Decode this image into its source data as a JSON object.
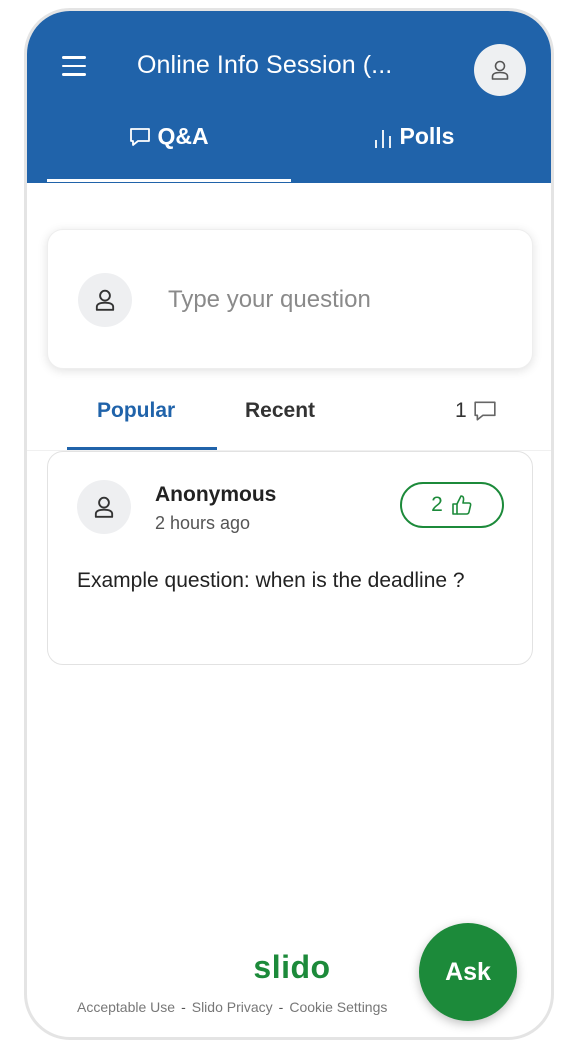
{
  "header": {
    "event_title": "Online Info Session (...",
    "background_color": "#2063aa",
    "menu_icon": "hamburger-menu-icon",
    "avatar_icon": "user-icon"
  },
  "tabs": [
    {
      "label": "Q&A",
      "icon": "speech-bubble-icon",
      "active": true
    },
    {
      "label": "Polls",
      "icon": "bar-chart-icon",
      "active": false
    }
  ],
  "ask_input": {
    "placeholder": "Type your question",
    "avatar_icon": "user-icon"
  },
  "sort": {
    "options": [
      "Popular",
      "Recent"
    ],
    "selected": "Popular",
    "question_count": "1",
    "count_icon": "speech-bubble-icon"
  },
  "questions": [
    {
      "author": "Anonymous",
      "time": "2 hours ago",
      "votes": "2",
      "text": "Example question: when is the deadline ?"
    }
  ],
  "footer": {
    "brand": "slido",
    "brand_color": "#1c8a3a",
    "links": [
      "Acceptable Use",
      "Slido Privacy",
      "Cookie Settings"
    ],
    "separator": "-"
  },
  "ask_button": {
    "label": "Ask",
    "color": "#1c8a3a"
  }
}
